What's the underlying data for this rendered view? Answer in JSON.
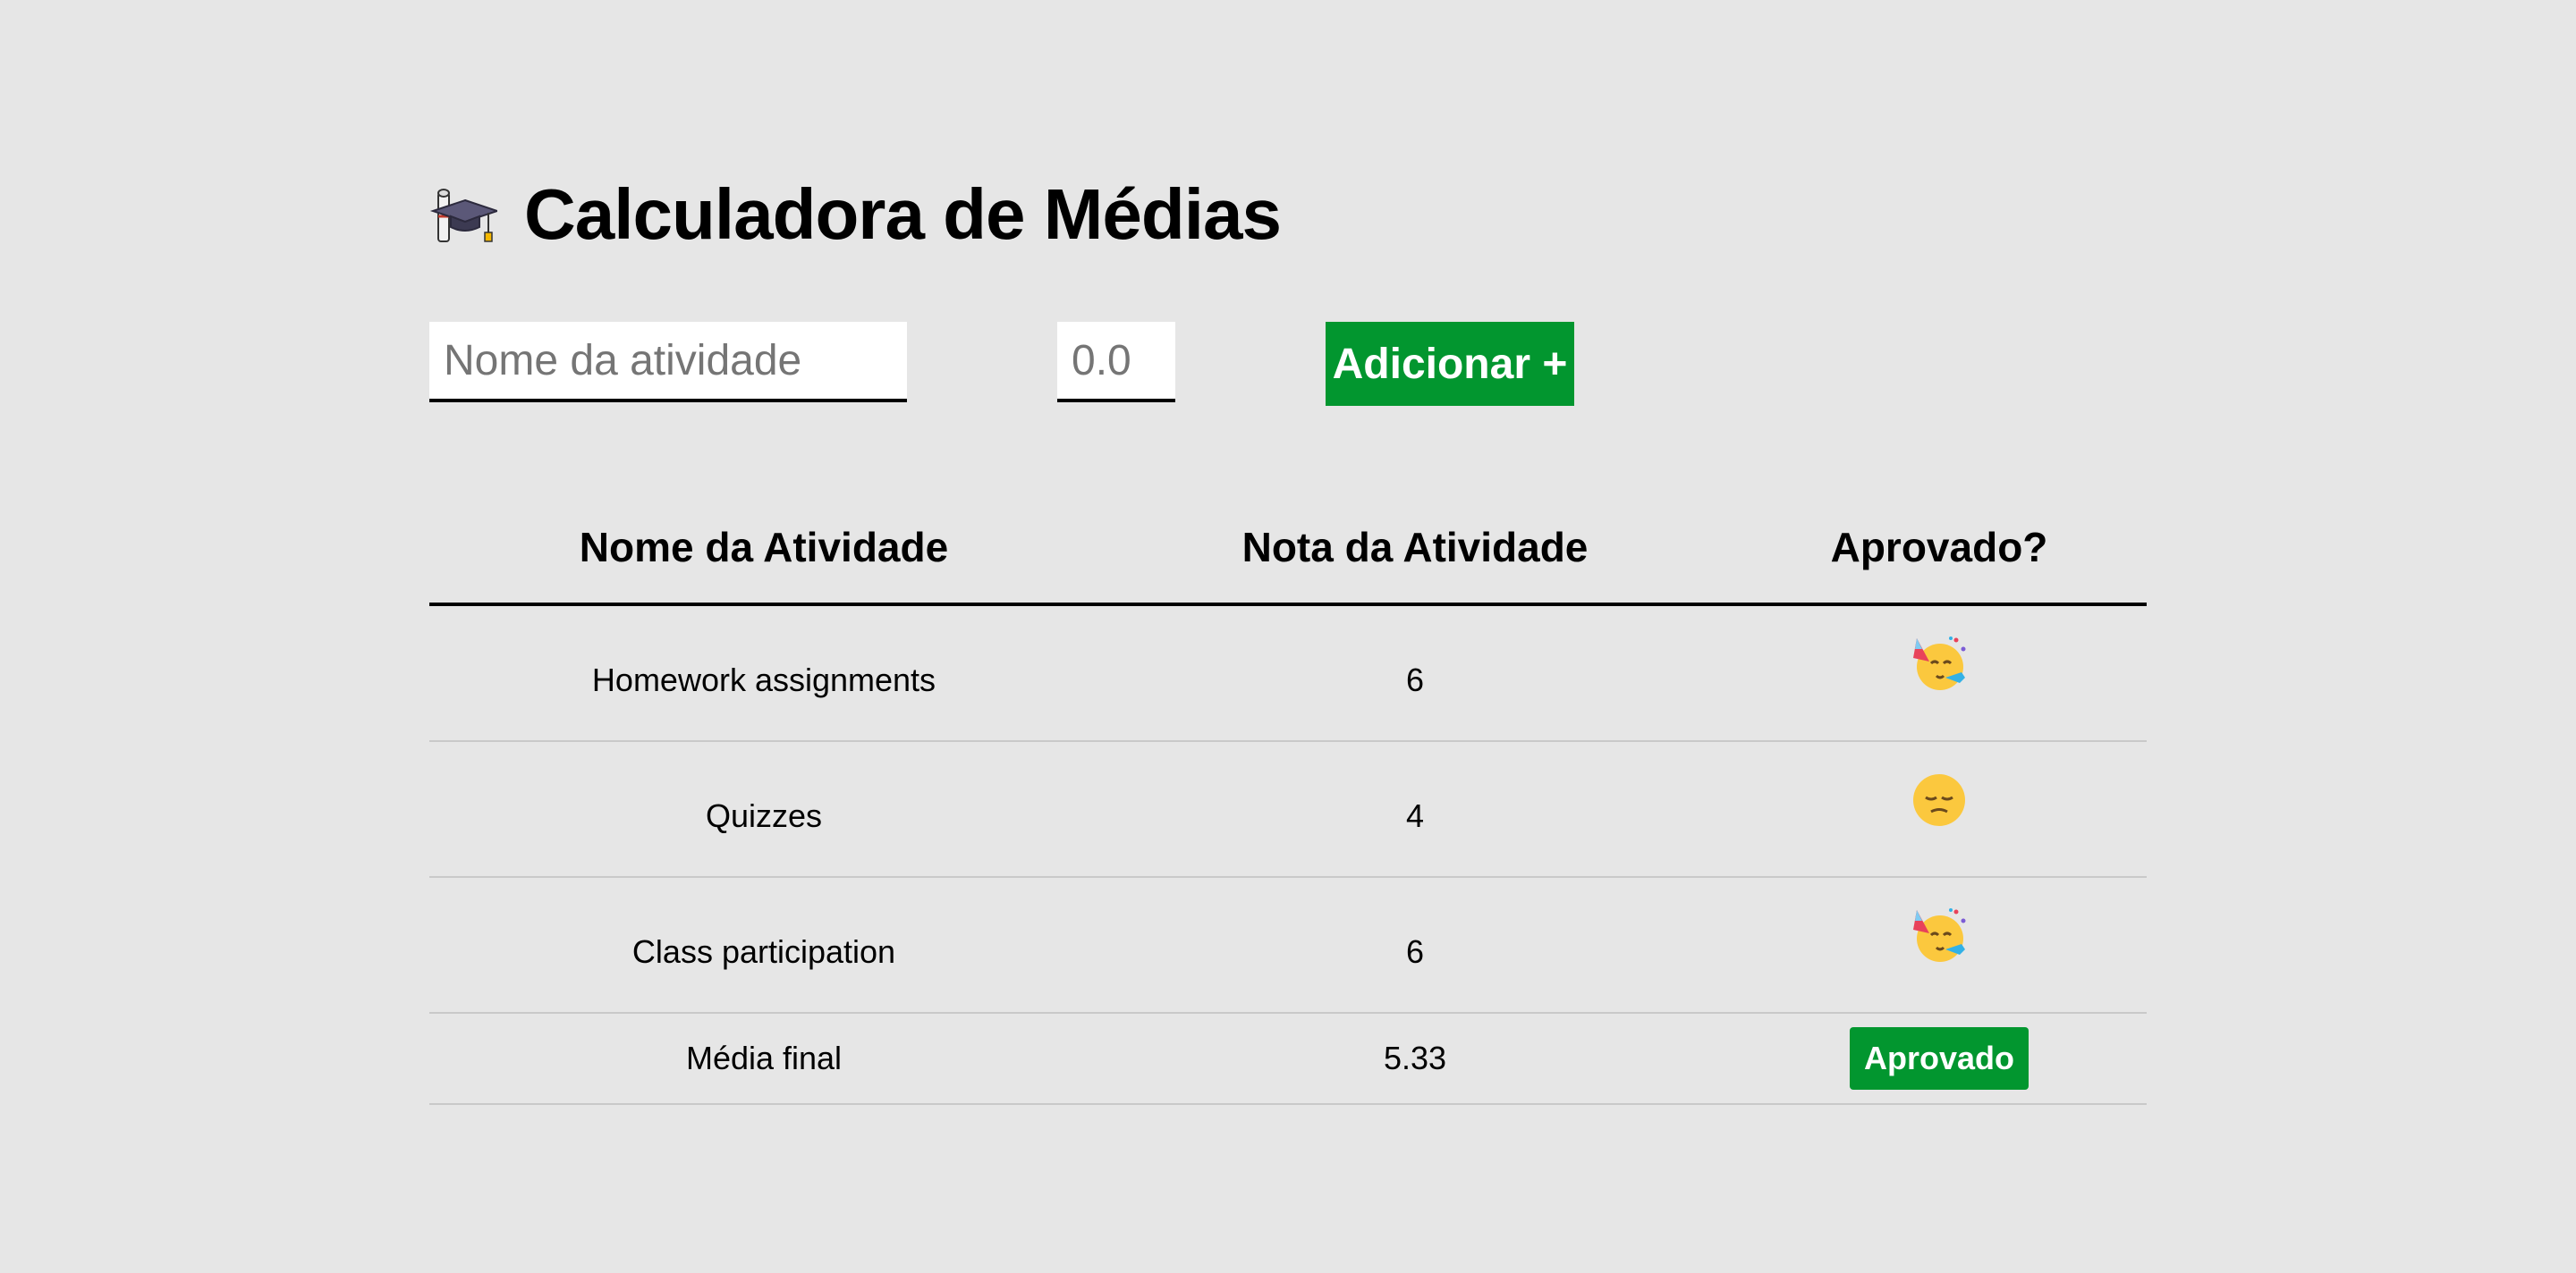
{
  "header": {
    "title": "Calculadora de Médias",
    "icon": "graduation-cap-icon"
  },
  "form": {
    "name_placeholder": "Nome da atividade",
    "grade_placeholder": "0.0",
    "add_label": "Adicionar +"
  },
  "table": {
    "headers": [
      "Nome da Atividade",
      "Nota da Atividade",
      "Aprovado?"
    ],
    "rows": [
      {
        "name": "Homework assignments",
        "grade": "6",
        "status_icon": "party-face-icon"
      },
      {
        "name": "Quizzes",
        "grade": "4",
        "status_icon": "pensive-face-icon"
      },
      {
        "name": "Class participation",
        "grade": "6",
        "status_icon": "party-face-icon"
      }
    ],
    "footer": {
      "label": "Média final",
      "average": "5.33",
      "status": "Aprovado"
    }
  },
  "colors": {
    "accent": "#02962f",
    "background": "#e6e6e6"
  }
}
